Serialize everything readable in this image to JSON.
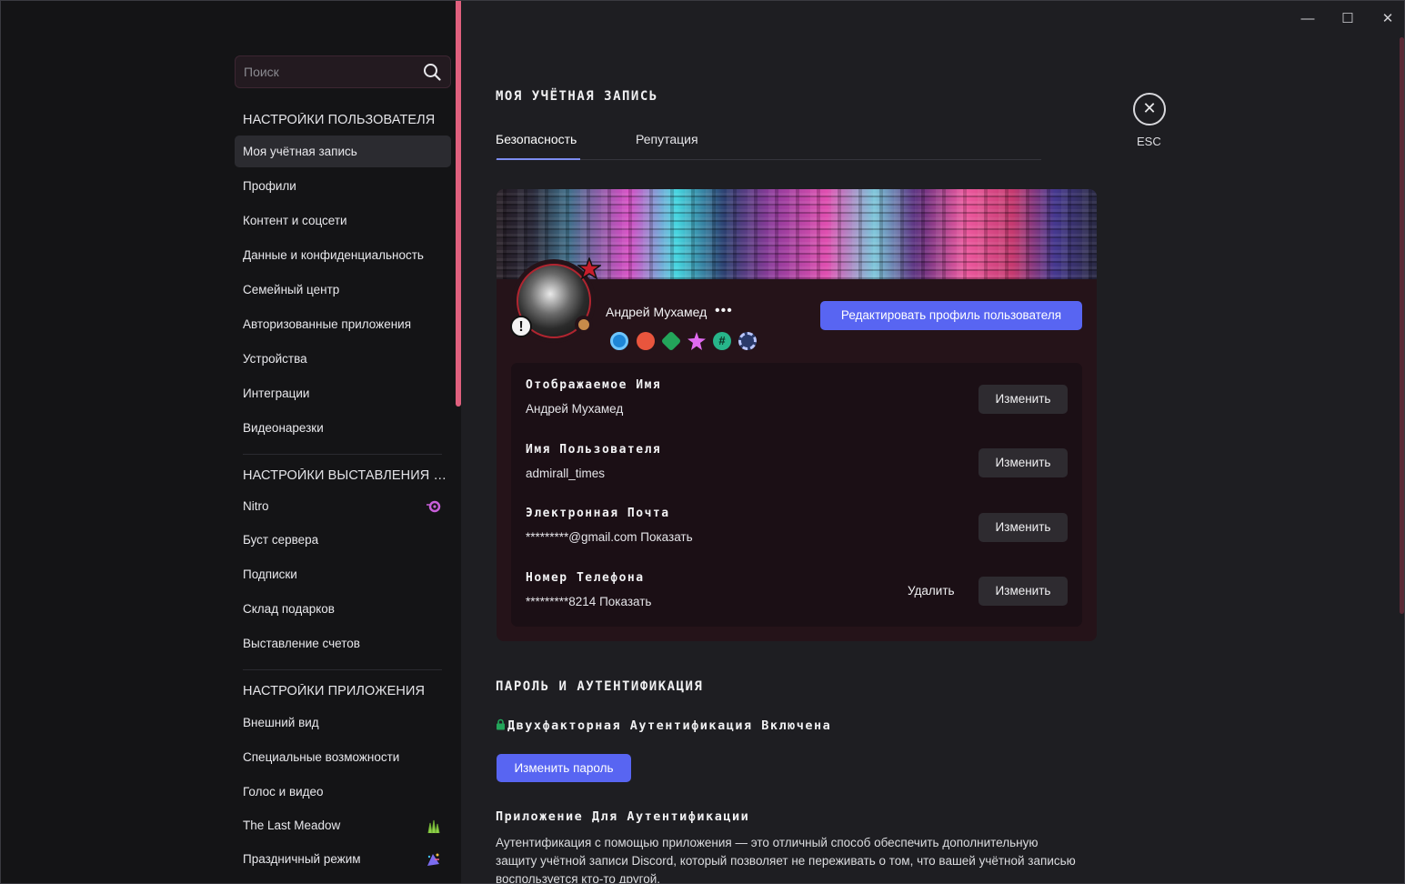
{
  "window": {
    "minimize": "—",
    "maximize": "☐",
    "close": "✕"
  },
  "sidebar": {
    "search": {
      "placeholder": "Поиск"
    },
    "sections": [
      {
        "title": "НАСТРОЙКИ ПОЛЬЗОВАТЕЛЯ"
      },
      {
        "title": "НАСТРОЙКИ ВЫСТАВЛЕНИЯ СЧЕТОВ"
      },
      {
        "title": "НАСТРОЙКИ ПРИЛОЖЕНИЯ"
      }
    ],
    "user_items": [
      "Моя учётная запись",
      "Профили",
      "Контент и соцсети",
      "Данные и конфиденциальность",
      "Семейный центр",
      "Авторизованные приложения",
      "Устройства",
      "Интеграции",
      "Видеонарезки"
    ],
    "billing_items": [
      "Nitro",
      "Буст сервера",
      "Подписки",
      "Склад подарков",
      "Выставление счетов"
    ],
    "app_items": [
      "Внешний вид",
      "Специальные возможности",
      "Голос и видео",
      "The Last Meadow",
      "Праздничный режим"
    ],
    "active_item": "Моя учётная запись",
    "accent_color": "#e0607e"
  },
  "main": {
    "title": "МОЯ УЧЁТНАЯ ЗАПИСЬ",
    "tabs": [
      {
        "label": "Безопасность",
        "active": true
      },
      {
        "label": "Репутация",
        "active": false
      }
    ],
    "close": {
      "icon": "close-icon",
      "label": "ESC"
    },
    "profile": {
      "display_name": "Андрей Мухамед",
      "more": "•••",
      "edit_button": "Редактировать профиль пользователя",
      "status": "idle",
      "badges": [
        "nitro-badge",
        "boost-badge",
        "hypesquad-badge",
        "quest-badge",
        "hashtag-badge",
        "gear-badge"
      ]
    },
    "fields": [
      {
        "label": "Отображаемое Имя",
        "value": "Андрей Мухамед",
        "button": "Изменить"
      },
      {
        "label": "Имя Пользователя",
        "value": "admirall_times",
        "button": "Изменить"
      },
      {
        "label": "Электронная Почта",
        "value": "*********@gmail.com Показать",
        "button": "Изменить"
      },
      {
        "label": "Номер Телефона",
        "value": "*********8214 Показать",
        "button": "Изменить",
        "delete": "Удалить"
      }
    ],
    "password_section": {
      "title": "ПАРОЛЬ И АУТЕНТИФИКАЦИЯ",
      "twofa": "Двухфакторная Аутентификация Включена",
      "change_password": "Изменить пароль",
      "app_title": "Приложение Для Аутентификации",
      "app_desc": "Аутентификация с помощью приложения — это отличный способ обеспечить дополнительную защиту учётной записи Discord, который позволяет не переживать о том, что вашей учётной записью воспользуется кто-то другой."
    },
    "brand_color": "#5865f2"
  }
}
